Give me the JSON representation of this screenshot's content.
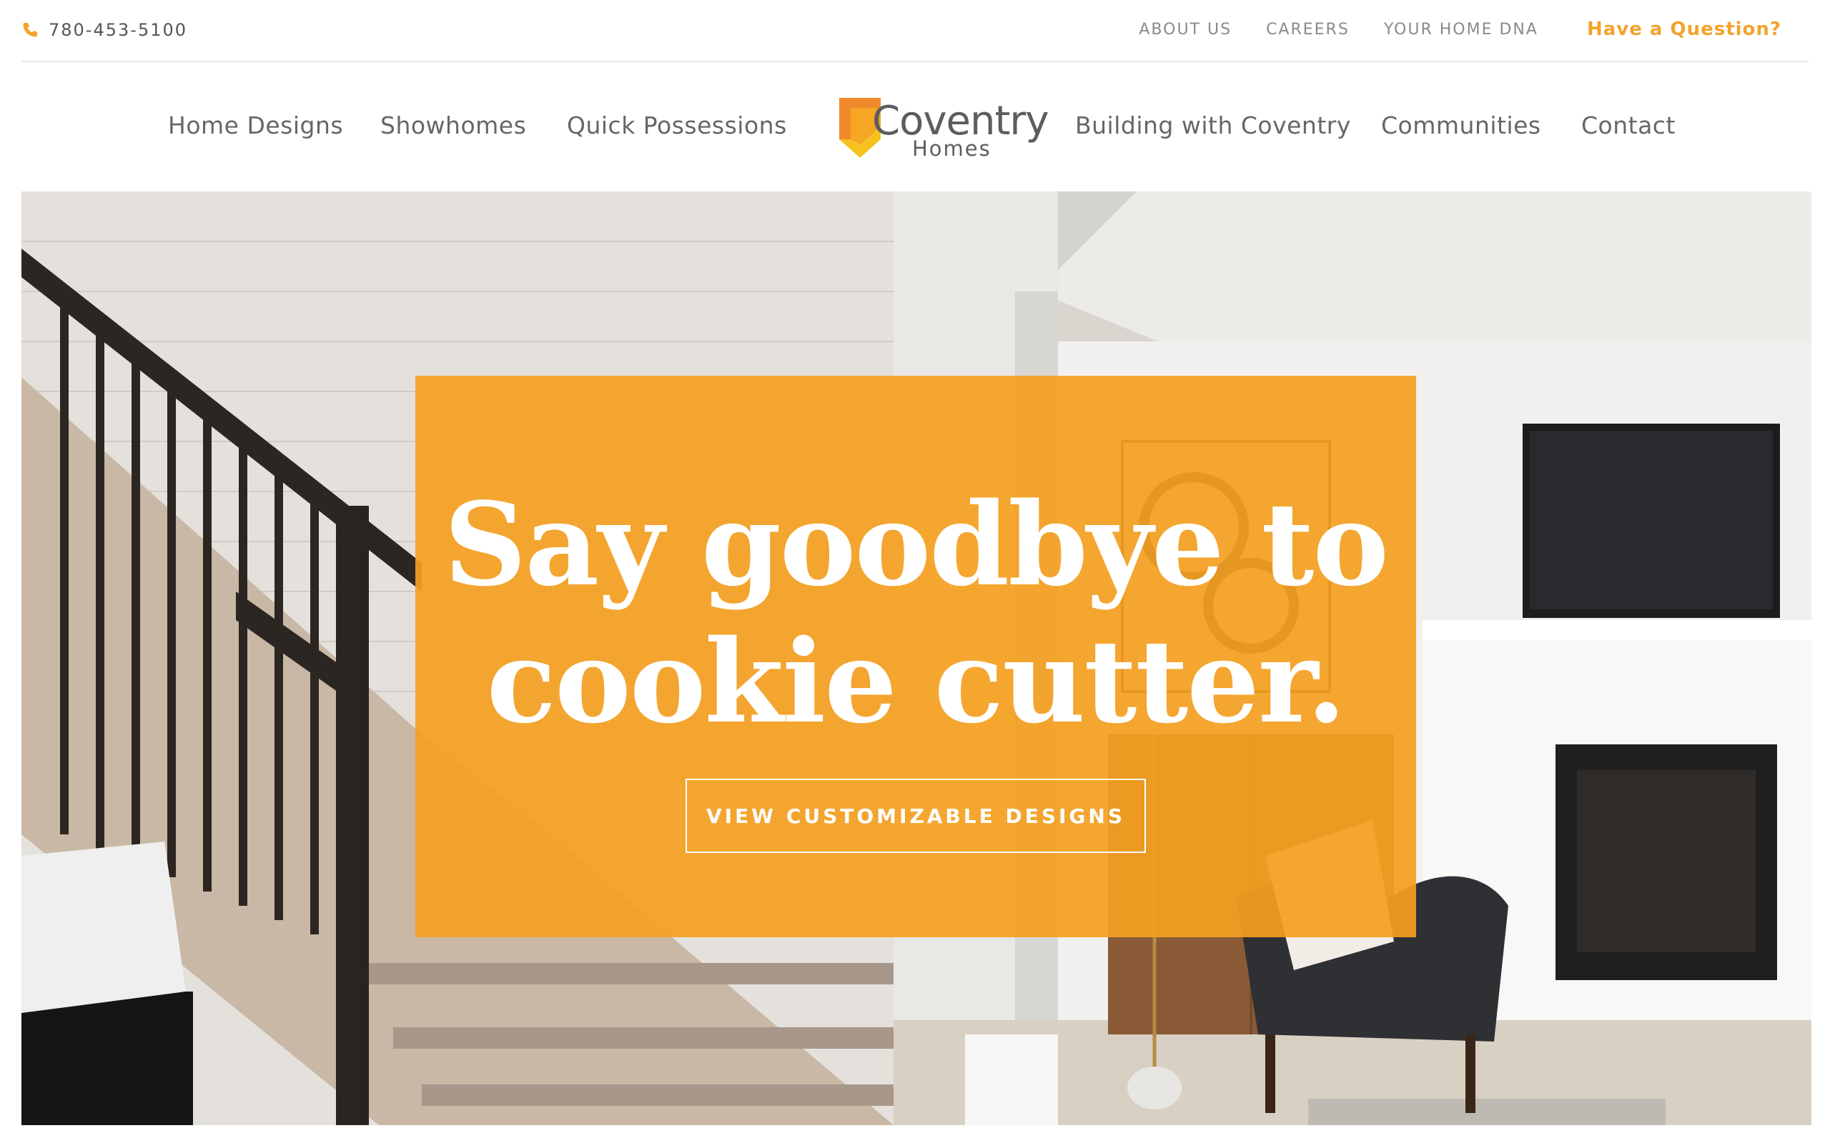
{
  "topbar": {
    "phone": "780-453-5100",
    "links": [
      "ABOUT US",
      "CAREERS",
      "YOUR HOME DNA"
    ],
    "cta": "Have a Question?"
  },
  "nav": {
    "left": [
      "Home Designs",
      "Showhomes",
      "Quick Possessions"
    ],
    "right": [
      "Building with Coventry",
      "Communities",
      "Contact"
    ]
  },
  "logo": {
    "word": "Coventry",
    "sub": "Homes"
  },
  "hero": {
    "headline_line1": "Say goodbye to",
    "headline_line2": "cookie cutter.",
    "button": "VIEW CUSTOMIZABLE DESIGNS"
  },
  "colors": {
    "accent": "#f3a32c",
    "overlay": "#f4a020",
    "text": "#666666"
  },
  "icons": {
    "phone": "phone-icon",
    "logo_mark": "house-chevron-logo-icon"
  }
}
